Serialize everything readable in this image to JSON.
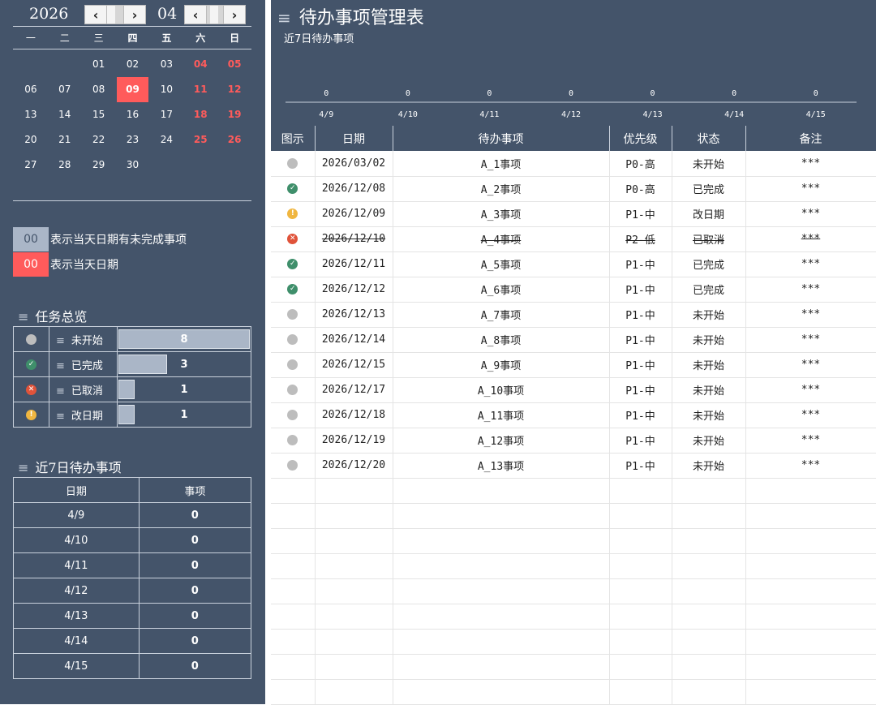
{
  "calendar": {
    "year": "2026",
    "month": "04",
    "weekdays": [
      "一",
      "二",
      "三",
      "四",
      "五",
      "六",
      "日"
    ],
    "weeks": [
      [
        "",
        "",
        "01",
        "02",
        "03",
        "04",
        "05"
      ],
      [
        "06",
        "07",
        "08",
        "09",
        "10",
        "11",
        "12"
      ],
      [
        "13",
        "14",
        "15",
        "16",
        "17",
        "18",
        "19"
      ],
      [
        "20",
        "21",
        "22",
        "23",
        "24",
        "25",
        "26"
      ],
      [
        "27",
        "28",
        "29",
        "30",
        "",
        "",
        ""
      ]
    ],
    "today": "09"
  },
  "legend": [
    {
      "swatch": "00",
      "text": "表示当天日期有未完成事项",
      "color": "#aab6c7"
    },
    {
      "swatch": "00",
      "text": "表示当天日期",
      "color": "#ff5b5b"
    }
  ],
  "overview": {
    "title": "任务总览",
    "rows": [
      {
        "icon": "grey",
        "name": "未开始",
        "value": "8",
        "fraction": 1.0
      },
      {
        "icon": "green",
        "name": "已完成",
        "value": "3",
        "fraction": 0.375
      },
      {
        "icon": "red",
        "name": "已取消",
        "value": "1",
        "fraction": 0.125
      },
      {
        "icon": "yellow",
        "name": "改日期",
        "value": "1",
        "fraction": 0.125
      }
    ]
  },
  "recent": {
    "title": "近7日待办事项",
    "headers": [
      "日期",
      "事项"
    ],
    "rows": [
      [
        "4/9",
        "0"
      ],
      [
        "4/10",
        "0"
      ],
      [
        "4/11",
        "0"
      ],
      [
        "4/12",
        "0"
      ],
      [
        "4/13",
        "0"
      ],
      [
        "4/14",
        "0"
      ],
      [
        "4/15",
        "0"
      ]
    ]
  },
  "main": {
    "title": "待办事项管理表",
    "subtitle": "近7日待办事项"
  },
  "chart_data": {
    "type": "bar",
    "categories": [
      "4/9",
      "4/10",
      "4/11",
      "4/12",
      "4/13",
      "4/14",
      "4/15"
    ],
    "values": [
      0,
      0,
      0,
      0,
      0,
      0,
      0
    ],
    "title": "近7日待办事项",
    "xlabel": "",
    "ylabel": "",
    "grid": false
  },
  "table": {
    "headers": [
      "图示",
      "日期",
      "待办事项",
      "优先级",
      "状态",
      "备注"
    ],
    "rows": [
      {
        "icon": "grey",
        "date": "2026/03/02",
        "task": "A_1事项",
        "priority": "P0-高",
        "status": "未开始",
        "note": "***"
      },
      {
        "icon": "green",
        "date": "2026/12/08",
        "task": "A_2事项",
        "priority": "P0-高",
        "status": "已完成",
        "note": "***"
      },
      {
        "icon": "yellow",
        "date": "2026/12/09",
        "task": "A_3事项",
        "priority": "P1-中",
        "status": "改日期",
        "note": "***"
      },
      {
        "icon": "red",
        "date": "2026/12/10",
        "task": "A_4事项",
        "priority": "P2-低",
        "status": "已取消",
        "note": "***"
      },
      {
        "icon": "green",
        "date": "2026/12/11",
        "task": "A_5事项",
        "priority": "P1-中",
        "status": "已完成",
        "note": "***"
      },
      {
        "icon": "green",
        "date": "2026/12/12",
        "task": "A_6事项",
        "priority": "P1-中",
        "status": "已完成",
        "note": "***"
      },
      {
        "icon": "grey",
        "date": "2026/12/13",
        "task": "A_7事项",
        "priority": "P1-中",
        "status": "未开始",
        "note": "***"
      },
      {
        "icon": "grey",
        "date": "2026/12/14",
        "task": "A_8事项",
        "priority": "P1-中",
        "status": "未开始",
        "note": "***"
      },
      {
        "icon": "grey",
        "date": "2026/12/15",
        "task": "A_9事项",
        "priority": "P1-中",
        "status": "未开始",
        "note": "***"
      },
      {
        "icon": "grey",
        "date": "2026/12/17",
        "task": "A_10事项",
        "priority": "P1-中",
        "status": "未开始",
        "note": "***"
      },
      {
        "icon": "grey",
        "date": "2026/12/18",
        "task": "A_11事项",
        "priority": "P1-中",
        "status": "未开始",
        "note": "***"
      },
      {
        "icon": "grey",
        "date": "2026/12/19",
        "task": "A_12事项",
        "priority": "P1-中",
        "status": "未开始",
        "note": "***"
      },
      {
        "icon": "grey",
        "date": "2026/12/20",
        "task": "A_13事项",
        "priority": "P1-中",
        "status": "未开始",
        "note": "***"
      }
    ],
    "cancelled_status": "已取消"
  },
  "colors": {
    "panel": "#44546a",
    "accent_red": "#ff5b5b",
    "bar_fill": "#aab6c7",
    "status_green": "#3f8f6b",
    "status_red": "#e0533a",
    "status_yellow": "#f0b640",
    "status_grey": "#bdbdbd"
  },
  "icons": {
    "grey": "not-started-icon",
    "green": "check-circle-icon",
    "red": "x-circle-icon",
    "yellow": "exclamation-circle-icon",
    "menu": "hamburger-icon"
  }
}
